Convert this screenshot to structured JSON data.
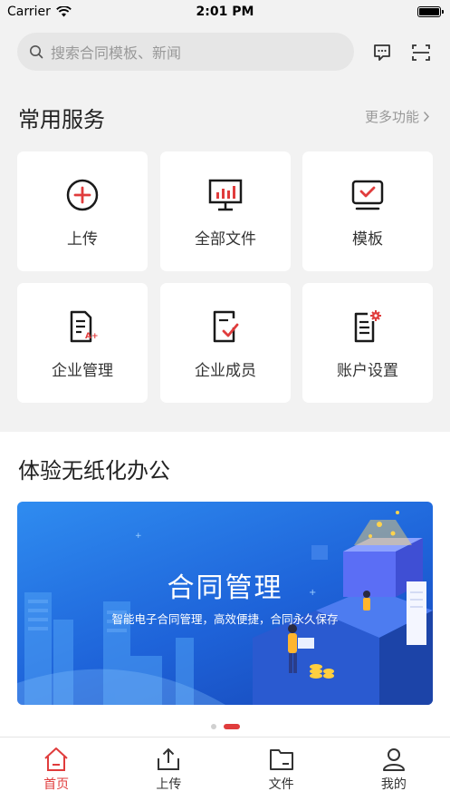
{
  "status_bar": {
    "carrier": "Carrier",
    "time": "2:01 PM"
  },
  "search": {
    "placeholder": "搜索合同模板、新闻"
  },
  "top_icons": [
    "message-icon",
    "scan-icon"
  ],
  "services": {
    "title": "常用服务",
    "more_label": "更多功能",
    "items": [
      {
        "label": "上传",
        "icon": "upload-plus-icon"
      },
      {
        "label": "全部文件",
        "icon": "monitor-chart-icon"
      },
      {
        "label": "模板",
        "icon": "template-icon"
      },
      {
        "label": "企业管理",
        "icon": "document-a-plus-icon"
      },
      {
        "label": "企业成员",
        "icon": "document-check-icon"
      },
      {
        "label": "账户设置",
        "icon": "document-gear-icon"
      }
    ]
  },
  "feature": {
    "title": "体验无纸化办公",
    "banner_title": "合同管理",
    "banner_subtitle": "智能电子合同管理，高效便捷，合同永久保存"
  },
  "pagination": {
    "total": 2,
    "active": 1
  },
  "tabs": [
    {
      "label": "首页",
      "icon": "home-icon",
      "active": true
    },
    {
      "label": "上传",
      "icon": "upload-icon",
      "active": false
    },
    {
      "label": "文件",
      "icon": "folder-icon",
      "active": false
    },
    {
      "label": "我的",
      "icon": "user-icon",
      "active": false
    }
  ],
  "colors": {
    "accent": "#e03c3c",
    "banner": "#1e63d9",
    "background": "#f2f2f2"
  }
}
